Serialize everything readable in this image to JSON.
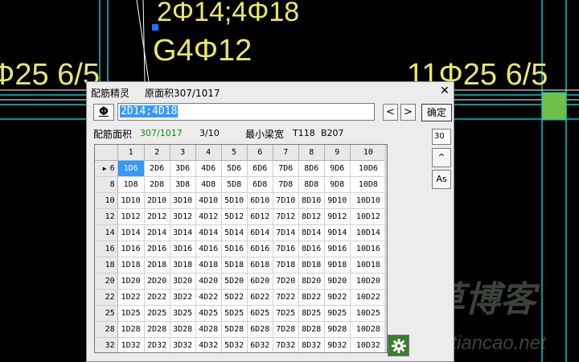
{
  "cad": {
    "top_text": "2Φ14;4Φ18",
    "mid_text": "G4Φ12",
    "left_text": "Φ25 6/5",
    "right_text": "11Φ25 6/5"
  },
  "watermark": {
    "brand": "田草博客",
    "url": "www.tiancao.net"
  },
  "dialog": {
    "title": "配筋精灵",
    "subtitle": "原面积307/1017",
    "close_label": "✕",
    "phi_label": "Φ",
    "input_value": "2D14;4D18",
    "prev_label": "<",
    "next_label": ">",
    "ok_label": "确定",
    "area_label": "配筋面积",
    "area_value": "307/1017",
    "count_value": "3/10",
    "min_width_label": "最小梁宽",
    "t_value": "T118",
    "b_value": "B207",
    "spin_value": "30",
    "up_label": "^",
    "as_label": "As"
  },
  "grid": {
    "columns": [
      "1",
      "2",
      "3",
      "4",
      "5",
      "6",
      "7",
      "8",
      "9",
      "10"
    ],
    "rows": [
      {
        "label": "6",
        "cells": [
          "1D6",
          "2D6",
          "3D6",
          "4D6",
          "5D6",
          "6D6",
          "7D6",
          "8D6",
          "9D6",
          "10D6"
        ]
      },
      {
        "label": "8",
        "cells": [
          "1D8",
          "2D8",
          "3D8",
          "4D8",
          "5D8",
          "6D8",
          "7D8",
          "8D8",
          "9D8",
          "10D8"
        ]
      },
      {
        "label": "10",
        "cells": [
          "1D10",
          "2D10",
          "3D10",
          "4D10",
          "5D10",
          "6D10",
          "7D10",
          "8D10",
          "9D10",
          "10D10"
        ]
      },
      {
        "label": "12",
        "cells": [
          "1D12",
          "2D12",
          "3D12",
          "4D12",
          "5D12",
          "6D12",
          "7D12",
          "8D12",
          "9D12",
          "10D12"
        ]
      },
      {
        "label": "14",
        "cells": [
          "1D14",
          "2D14",
          "3D14",
          "4D14",
          "5D14",
          "6D14",
          "7D14",
          "8D14",
          "9D14",
          "10D14"
        ]
      },
      {
        "label": "16",
        "cells": [
          "1D16",
          "2D16",
          "3D16",
          "4D16",
          "5D16",
          "6D16",
          "7D16",
          "8D16",
          "9D16",
          "10D16"
        ]
      },
      {
        "label": "18",
        "cells": [
          "1D18",
          "2D18",
          "3D18",
          "4D18",
          "5D18",
          "6D18",
          "7D18",
          "8D18",
          "9D18",
          "10D18"
        ]
      },
      {
        "label": "20",
        "cells": [
          "1D20",
          "2D20",
          "3D20",
          "4D20",
          "5D20",
          "6D20",
          "7D20",
          "8D20",
          "9D20",
          "10D20"
        ]
      },
      {
        "label": "22",
        "cells": [
          "1D22",
          "2D22",
          "3D22",
          "4D22",
          "5D22",
          "6D22",
          "7D22",
          "8D22",
          "9D22",
          "10D22"
        ]
      },
      {
        "label": "25",
        "cells": [
          "1D25",
          "2D25",
          "3D25",
          "4D25",
          "5D25",
          "6D25",
          "7D25",
          "8D25",
          "9D25",
          "10D25"
        ]
      },
      {
        "label": "28",
        "cells": [
          "1D28",
          "2D28",
          "3D28",
          "4D28",
          "5D28",
          "6D28",
          "7D28",
          "8D28",
          "9D28",
          "10D28"
        ]
      },
      {
        "label": "32",
        "cells": [
          "1D32",
          "2D32",
          "3D32",
          "4D32",
          "5D32",
          "6D32",
          "7D32",
          "8D32",
          "9D32",
          "10D32"
        ]
      }
    ],
    "current_row_marker": "▶"
  }
}
